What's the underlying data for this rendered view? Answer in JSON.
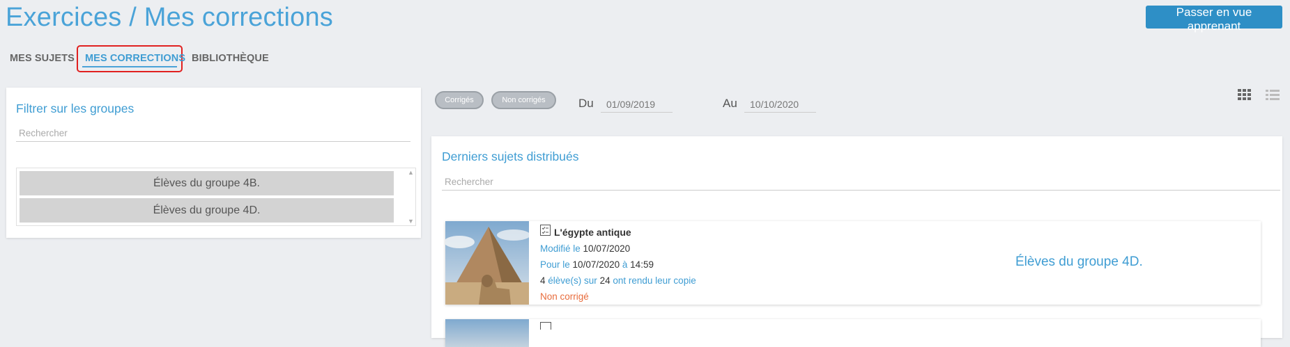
{
  "header": {
    "title": "Exercices / Mes corrections",
    "switch_button": "Passer en vue apprenant"
  },
  "tabs": [
    {
      "label": "MES SUJETS"
    },
    {
      "label": "MES CORRECTIONS",
      "active": true
    },
    {
      "label": "BIBLIOTHÈQUE"
    }
  ],
  "group_filter": {
    "title": "Filtrer sur les groupes",
    "search_placeholder": "Rechercher",
    "groups": [
      "Élèves du groupe 4B.",
      "Élèves du groupe 4D."
    ]
  },
  "filters": {
    "pill_corrected": "Corrigés",
    "pill_uncorrected": "Non corrigés",
    "from_label": "Du",
    "from_value": "01/09/2019",
    "to_label": "Au",
    "to_value": "10/10/2020"
  },
  "view_icons": [
    "grid-view-icon",
    "list-view-icon"
  ],
  "subjects": {
    "title": "Derniers sujets distribués",
    "search_placeholder": "Rechercher",
    "items": [
      {
        "title": "L'égypte antique",
        "modified_label": "Modifié le",
        "modified_date": "10/07/2020",
        "due_label": "Pour le",
        "due_date": "10/07/2020",
        "at_label": "à",
        "due_time": "14:59",
        "submitted_count": "4",
        "students_of_label": "élève(s) sur",
        "total_count": "24",
        "submitted_label": "ont rendu leur copie",
        "status": "Non corrigé",
        "group": "Élèves du groupe 4D.",
        "icon": "quiz-list-icon"
      }
    ]
  },
  "colors": {
    "accent": "#3f9dd3",
    "button": "#2e8fc6",
    "status_uncorrected": "#e86c3c",
    "highlight_box": "#e02020"
  }
}
